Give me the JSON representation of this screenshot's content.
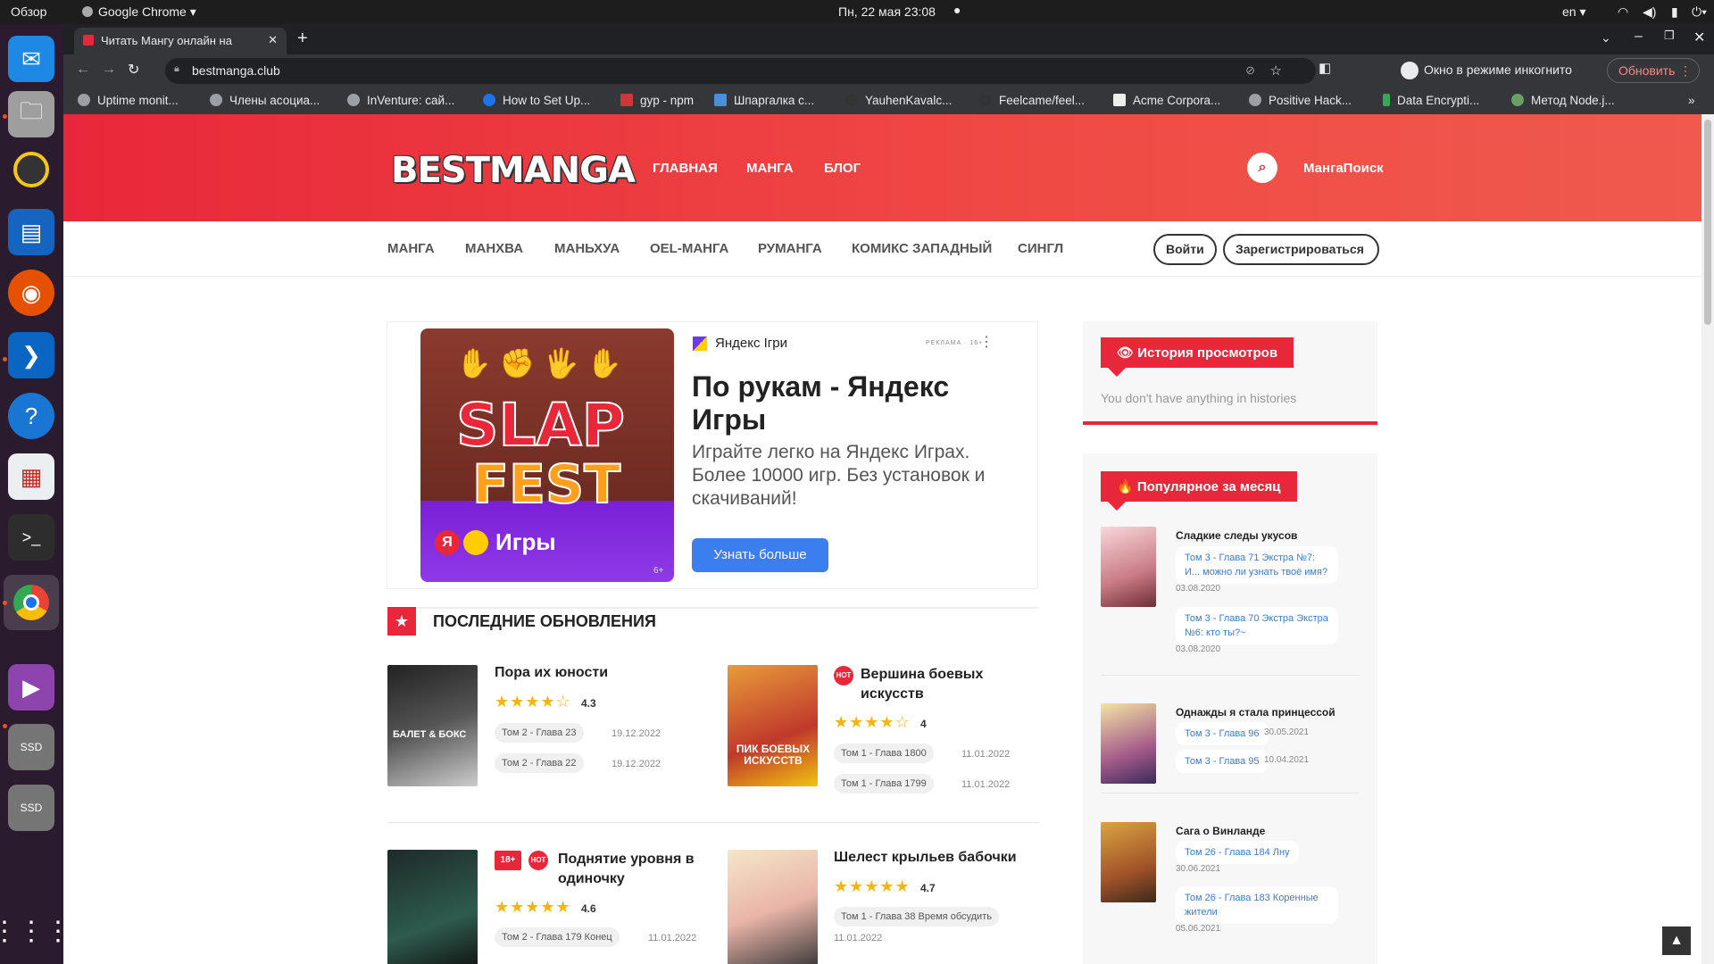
{
  "system": {
    "activities": "Обзор",
    "app": "Google Chrome ▾",
    "clock": "Пн, 22 мая  23:08",
    "lang": "en ▾"
  },
  "browser": {
    "tab_title": "Читать Мангу онлайн на",
    "url": "bestmanga.club",
    "incognito_label": "Окно в режиме инкогнито",
    "update_button": "Обновить",
    "bookmarks": [
      "Uptime monit...",
      "Члены асоциа...",
      "InVenture: сай...",
      "How to Set Up...",
      "gyp - npm",
      "Шпаргалка с...",
      "YauhenKavalc...",
      "Feelcame/feel...",
      "Acme Corpora...",
      "Positive Hack...",
      "Data Encrypti...",
      "Метод Node.j..."
    ]
  },
  "site": {
    "logo": "BESTMANGA",
    "nav": [
      "ГЛАВНАЯ",
      "МАНГА",
      "БЛОГ"
    ],
    "search_label": "МангаПоиск",
    "subnav": [
      "МАНГА",
      "МАНХВА",
      "МАНЬХУА",
      "OEL-МАНГА",
      "РУМАНГА",
      "КОМИКС ЗАПАДНЫЙ",
      "СИНГЛ"
    ],
    "login": "Войти",
    "register": "Зарегистрироваться"
  },
  "ad": {
    "brand": "Яндекс Ігри",
    "ad_label": "РЕКЛАМА · 16+",
    "headline": "По рукам - Яндекс Игры",
    "body": "Играйте легко на Яндекс Играх. Более 10000 игр. Без установок и скачиваний!",
    "cta": "Узнать больше",
    "image_text1": "SLAP",
    "image_text2": "FEST",
    "image_brand": "Игры",
    "image_age": "6+"
  },
  "latest": {
    "title": "ПОСЛЕДНИЕ ОБНОВЛЕНИЯ",
    "items": [
      {
        "title": "Пора их юности",
        "rating": "4.3",
        "stars": 4.3,
        "cover_text": "БАЛЕТ & БОКС",
        "chapters": [
          {
            "label": "Том 2 - Глава 23",
            "date": "19.12.2022"
          },
          {
            "label": "Том 2 - Глава 22",
            "date": "19.12.2022"
          }
        ]
      },
      {
        "title": "Вершина боевых искусств",
        "rating": "4",
        "stars": 4,
        "badge": "HOT",
        "cover_text": "ПИК БОЕВЫХ ИСКУССТВ",
        "chapters": [
          {
            "label": "Том 1 - Глава 1800",
            "date": "11.01.2022"
          },
          {
            "label": "Том 1 - Глава 1799",
            "date": "11.01.2022"
          }
        ]
      },
      {
        "title": "Поднятие уровня в одиночку",
        "rating": "4.6",
        "stars": 4.6,
        "badge": "HOT",
        "age_badge": "18+",
        "chapters": [
          {
            "label": "Том 2 - Глава 179 Конец",
            "date": "11.01.2022"
          }
        ]
      },
      {
        "title": "Шелест крыльев бабочки",
        "rating": "4.7",
        "stars": 4.7,
        "chapters": [
          {
            "label": "Том 1 - Глава 38 Время обсудить",
            "date": "11.01.2022"
          }
        ]
      }
    ]
  },
  "sidebar": {
    "history_title": "👁 История просмотров",
    "history_empty": "You don't have anything in histories",
    "popular_title": "🔥 Популярное за месяц",
    "popular": [
      {
        "title": "Сладкие следы укусов",
        "chapters": [
          {
            "label": "Том 3 - Глава 71 Экстра №7: И... можно ли узнать твоё имя?",
            "date": "03.08.2020"
          },
          {
            "label": "Том 3 - Глава 70 Экстра Экстра №6: кто ты?~",
            "date": "03.08.2020"
          }
        ]
      },
      {
        "title": "Однажды я стала принцессой",
        "chapters": [
          {
            "label": "Том 3 - Глава 96",
            "date": "30.05.2021"
          },
          {
            "label": "Том 3 - Глава 95",
            "date": "10.04.2021"
          }
        ]
      },
      {
        "title": "Сага о Винланде",
        "chapters": [
          {
            "label": "Том 26 - Глава 184 Лну",
            "date": "30.06.2021"
          },
          {
            "label": "Том 26 - Глава 183 Коренные жители",
            "date": "05.06.2021"
          }
        ]
      }
    ]
  }
}
